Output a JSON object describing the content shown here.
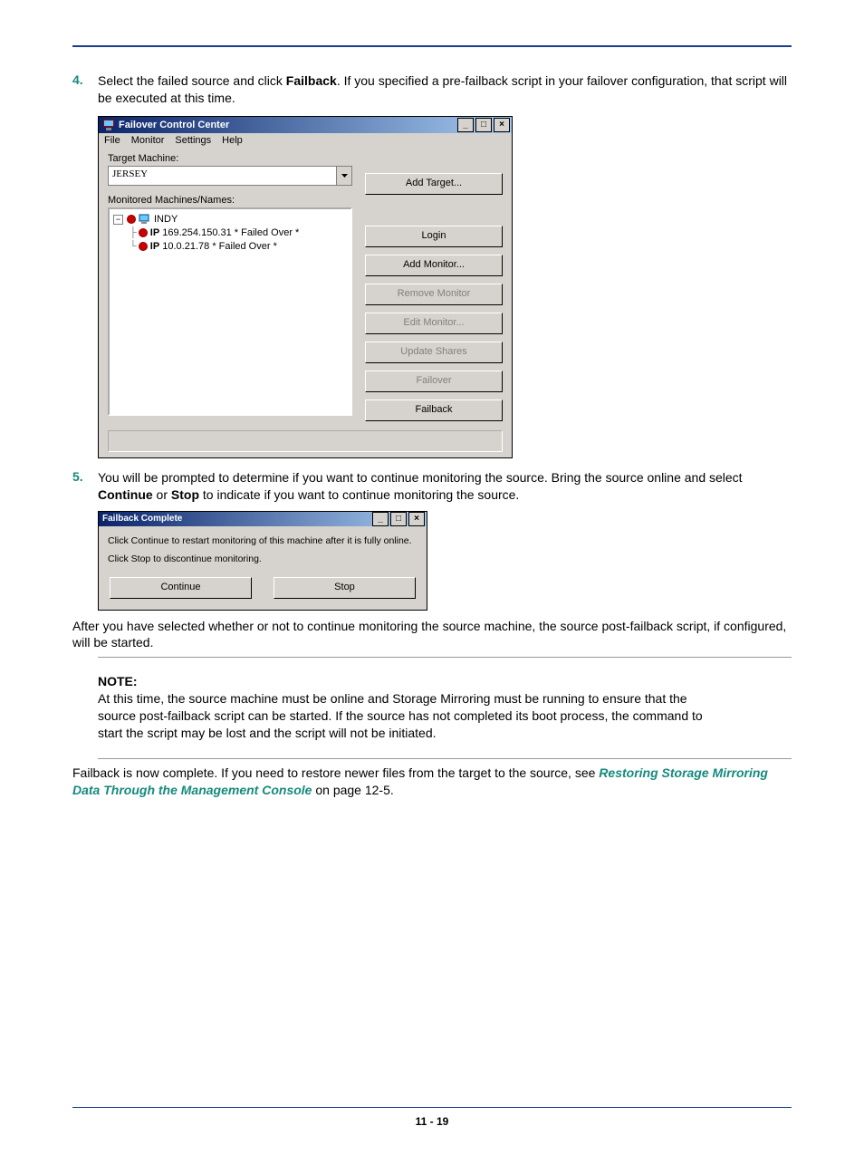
{
  "step4": {
    "num": "4.",
    "text_a": "Select the failed source and click ",
    "bold1": "Failback",
    "text_b": ". If you specified a pre-failback script in your failover configuration, that script will be executed at this time."
  },
  "fcc": {
    "title": "Failover Control Center",
    "menu": [
      "File",
      "Monitor",
      "Settings",
      "Help"
    ],
    "target_label": "Target Machine:",
    "target_value": "JERSEY",
    "monitored_label": "Monitored Machines/Names:",
    "tree": {
      "root": "INDY",
      "items": [
        {
          "ip": "IP",
          "addr": "169.254.150.31",
          "status": "* Failed Over *"
        },
        {
          "ip": "IP",
          "addr": "10.0.21.78",
          "status": "* Failed Over *"
        }
      ]
    },
    "buttons": {
      "add_target": "Add Target...",
      "login": "Login",
      "add_monitor": "Add Monitor...",
      "remove_monitor": "Remove Monitor",
      "edit_monitor": "Edit Monitor...",
      "update_shares": "Update Shares",
      "failover": "Failover",
      "failback": "Failback"
    }
  },
  "step5": {
    "num": "5.",
    "text_a": "You will be prompted to determine if you want to continue monitoring the source. Bring the source online and select ",
    "bold1": "Continue",
    "text_b": " or ",
    "bold2": "Stop",
    "text_c": " to indicate if you want to continue monitoring the source."
  },
  "fbc": {
    "title": "Failback Complete",
    "line1": "Click Continue to restart monitoring of this machine after it is fully online.",
    "line2": "Click Stop to discontinue monitoring.",
    "continue": "Continue",
    "stop": "Stop"
  },
  "after_text": "After you have selected whether or not to continue monitoring the source machine, the source post-failback script, if configured, will be started.",
  "note": {
    "label": "NOTE:",
    "text": "At this time, the source machine must be online and Storage Mirroring must be running to ensure that the source post-failback script can be started. If the source has not completed its boot process, the command to start the script may be lost and the script will not be initiated."
  },
  "final": {
    "text_a": "Failback is now complete. If you need to restore newer files from the target to the source, see ",
    "link": "Restoring Storage Mirroring Data Through the Management Console",
    "text_b": " on page 12-5."
  },
  "footer": "11 - 19"
}
